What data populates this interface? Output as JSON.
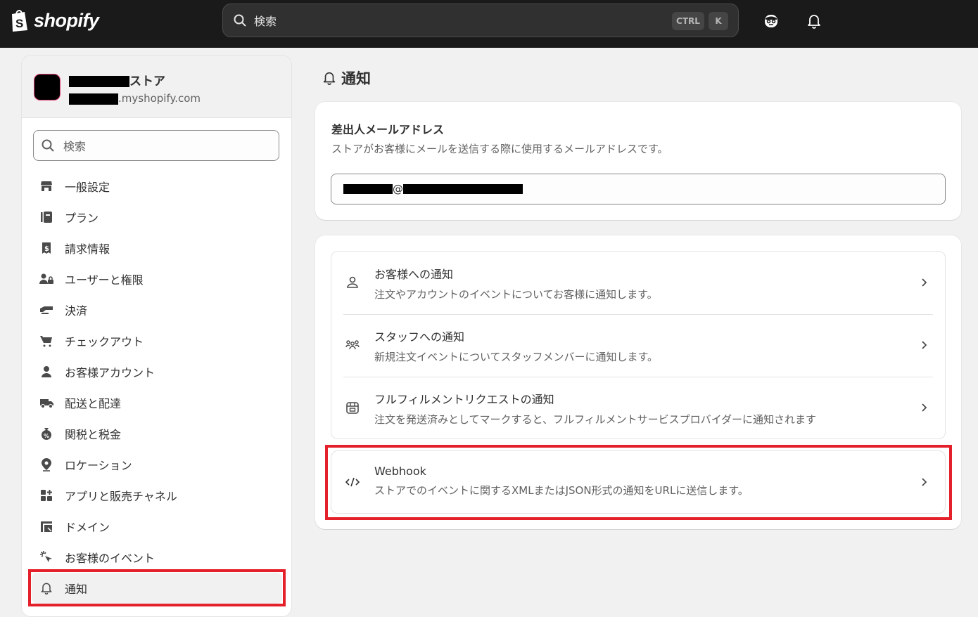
{
  "topbar": {
    "brand": "shopify",
    "search_placeholder": "検索",
    "shortcut_keys": [
      "CTRL",
      "K"
    ],
    "icons": [
      "shopify-bag-icon",
      "search-icon",
      "avatar-icon",
      "bell-icon"
    ]
  },
  "sidebar": {
    "store_name_suffix": "ストア",
    "store_domain_suffix": ".myshopify.com",
    "search_placeholder": "検索",
    "items": [
      {
        "label": "一般設定",
        "icon": "store-icon"
      },
      {
        "label": "プラン",
        "icon": "plan-icon"
      },
      {
        "label": "請求情報",
        "icon": "receipt-icon"
      },
      {
        "label": "ユーザーと権限",
        "icon": "users-lock-icon"
      },
      {
        "label": "決済",
        "icon": "payment-icon"
      },
      {
        "label": "チェックアウト",
        "icon": "cart-icon"
      },
      {
        "label": "お客様アカウント",
        "icon": "person-icon"
      },
      {
        "label": "配送と配達",
        "icon": "truck-icon"
      },
      {
        "label": "関税と税金",
        "icon": "tax-bag-icon"
      },
      {
        "label": "ロケーション",
        "icon": "location-icon"
      },
      {
        "label": "アプリと販売チャネル",
        "icon": "apps-icon"
      },
      {
        "label": "ドメイン",
        "icon": "domain-icon"
      },
      {
        "label": "お客様のイベント",
        "icon": "cursor-click-icon"
      },
      {
        "label": "通知",
        "icon": "bell-icon",
        "active": true
      }
    ]
  },
  "main": {
    "title": "通知",
    "sender": {
      "title": "差出人メールアドレス",
      "description": "ストアがお客様にメールを送信する際に使用するメールアドレスです。",
      "email_visible_char": "@"
    },
    "notifications": [
      {
        "title": "お客様への通知",
        "description": "注文やアカウントのイベントについてお客様に通知します。",
        "icon": "person-outline-icon"
      },
      {
        "title": "スタッフへの通知",
        "description": "新規注文イベントについてスタッフメンバーに通知します。",
        "icon": "staff-icon"
      },
      {
        "title": "フルフィルメントリクエストの通知",
        "description": "注文を発送済みとしてマークすると、フルフィルメントサービスプロバイダーに通知されます",
        "icon": "fulfillment-box-icon"
      }
    ],
    "webhook": {
      "title": "Webhook",
      "description": "ストアでのイベントに関するXMLまたはJSON形式の通知をURLに送信します。",
      "icon": "code-icon"
    }
  },
  "colors": {
    "topbar": "#1a1a1a",
    "highlight": "#e4202a",
    "background": "#f1f1f1"
  }
}
